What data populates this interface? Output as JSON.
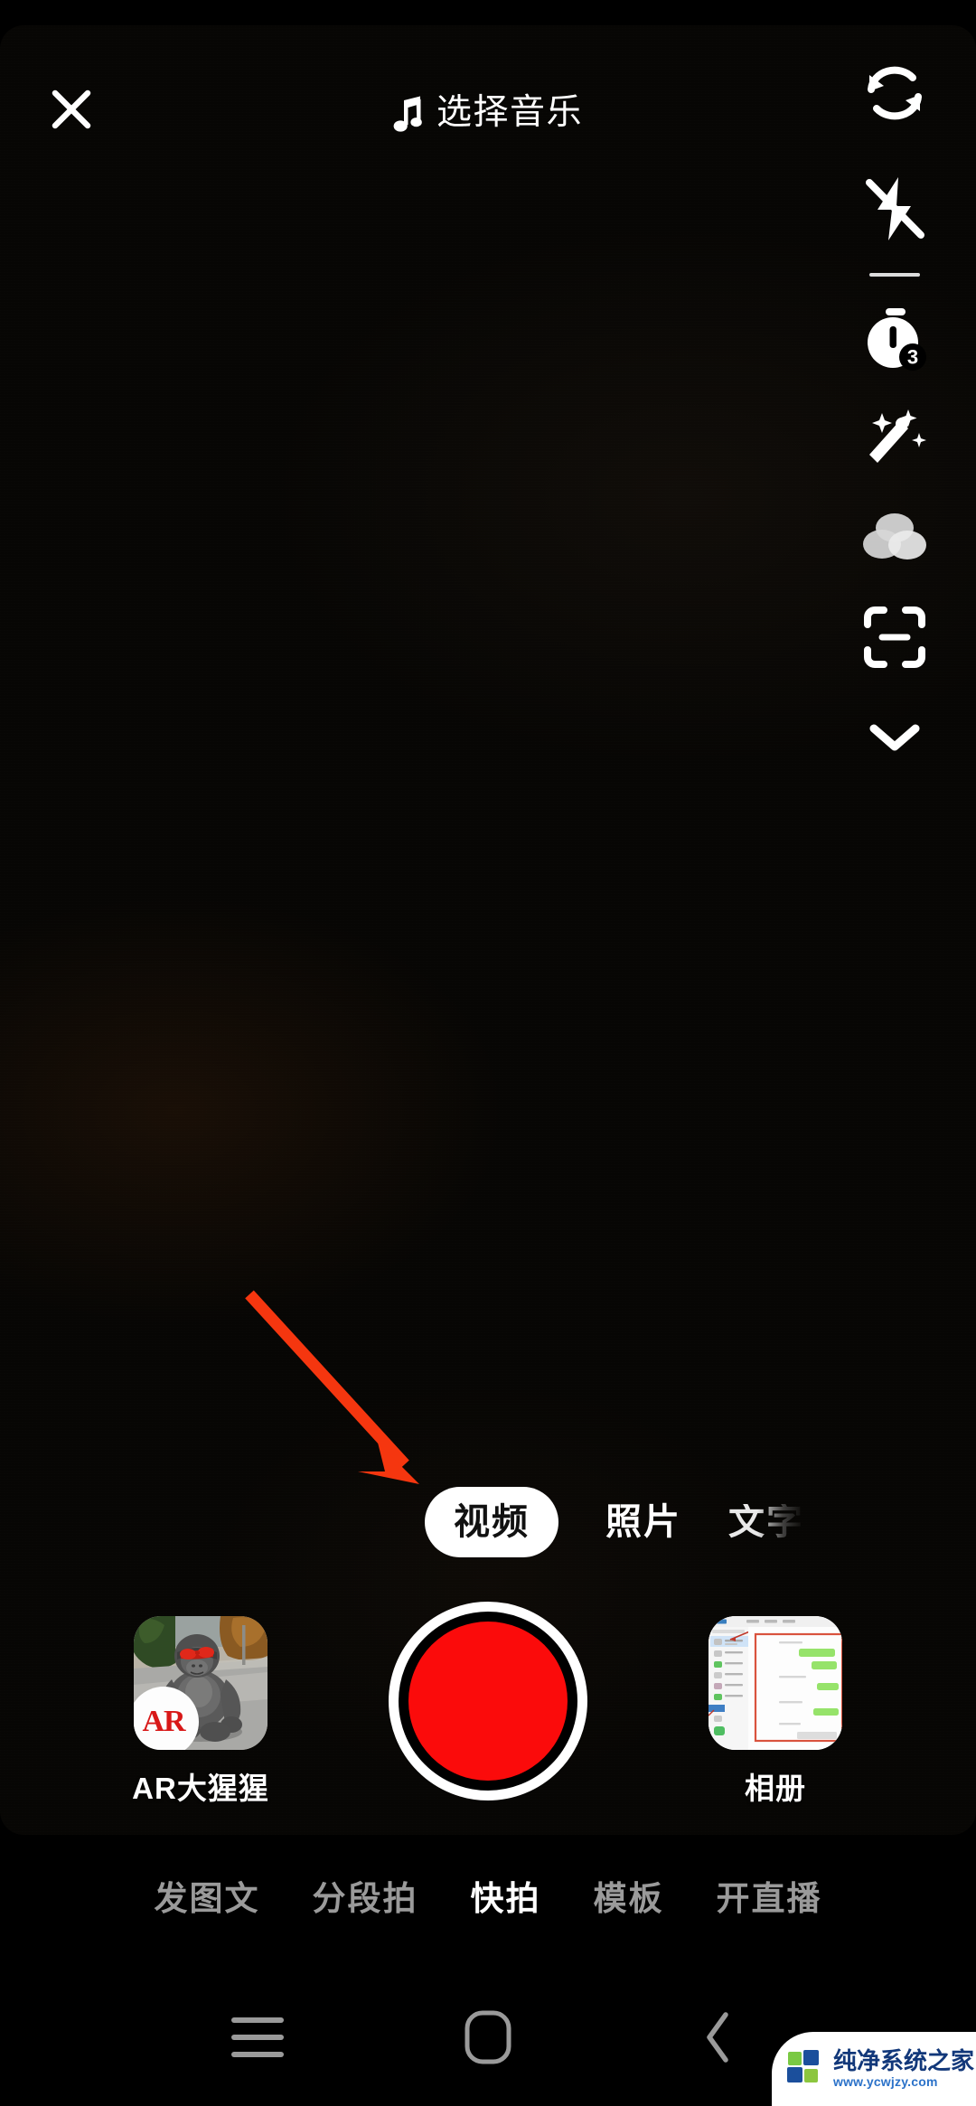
{
  "app": {
    "screen_name": "短视频拍摄",
    "background_color": "#000000"
  },
  "top_bar": {
    "close_icon": "close-icon",
    "music_icon": "music-note-icon",
    "music_label": "选择音乐"
  },
  "tool_rail": {
    "items": [
      {
        "icon": "flip-camera-icon",
        "name": "翻转"
      },
      {
        "icon": "flash-off-icon",
        "name": "闪光灯关闭"
      },
      {
        "icon": "timer-icon",
        "name": "倒计时",
        "badge": "3"
      },
      {
        "icon": "magic-wand-icon",
        "name": "美化"
      },
      {
        "icon": "filters-icon",
        "name": "滤镜"
      },
      {
        "icon": "scan-icon",
        "name": "扫一扫"
      },
      {
        "icon": "chevron-down-icon",
        "name": "展开更多"
      }
    ]
  },
  "annotation": {
    "arrow_color": "#F5360F",
    "points_to": "视频"
  },
  "mode_selector": {
    "selected": "视频",
    "items": [
      {
        "label": "视频",
        "state": "selected"
      },
      {
        "label": "照片",
        "state": "normal"
      },
      {
        "label": "文字",
        "state": "faded"
      }
    ]
  },
  "capture_row": {
    "effect": {
      "label": "AR大猩猩",
      "badge": "AR"
    },
    "record_button": {
      "name": "record-button",
      "color": "#FB0B0B",
      "ring_color": "#FFFFFF"
    },
    "album": {
      "label": "相册"
    }
  },
  "bottom_tabs": {
    "active": "快拍",
    "items": [
      {
        "label": "发图文",
        "active": false
      },
      {
        "label": "分段拍",
        "active": false
      },
      {
        "label": "快拍",
        "active": true
      },
      {
        "label": "模板",
        "active": false
      },
      {
        "label": "开直播",
        "active": false
      }
    ]
  },
  "nav_bar": {
    "recents_icon": "menu-icon",
    "home_icon": "home-icon",
    "back_icon": "back-chevron-icon"
  },
  "watermark": {
    "title": "纯净系统之家",
    "url": "www.ycwjzy.com",
    "logo_colors": [
      "#7AC943",
      "#1B4F9C",
      "#2F8FD8",
      "#8CC63F"
    ]
  }
}
